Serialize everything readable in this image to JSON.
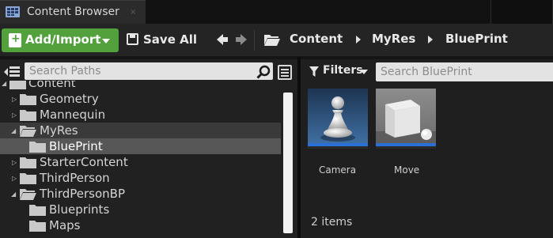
{
  "tab": {
    "title": "Content Browser",
    "icon": "content-browser-icon",
    "close_glyph": "×"
  },
  "toolbar": {
    "add_import_label": "Add/Import",
    "save_all_label": "Save All",
    "breadcrumbs": [
      "Content",
      "MyRes",
      "BluePrint"
    ],
    "accent_color": "#52a13c"
  },
  "sources": {
    "search_placeholder": "Search Paths",
    "tree": [
      {
        "label": "Content",
        "depth": 0,
        "expanded": true,
        "state": "normal"
      },
      {
        "label": "Geometry",
        "depth": 1,
        "expanded": false,
        "has_children": true,
        "state": "normal"
      },
      {
        "label": "Mannequin",
        "depth": 1,
        "expanded": false,
        "has_children": true,
        "state": "normal"
      },
      {
        "label": "MyRes",
        "depth": 1,
        "expanded": true,
        "has_children": true,
        "state": "hover"
      },
      {
        "label": "BluePrint",
        "depth": 2,
        "expanded": false,
        "has_children": false,
        "state": "selected"
      },
      {
        "label": "StarterContent",
        "depth": 1,
        "expanded": false,
        "has_children": true,
        "state": "normal"
      },
      {
        "label": "ThirdPerson",
        "depth": 1,
        "expanded": false,
        "has_children": true,
        "state": "normal"
      },
      {
        "label": "ThirdPersonBP",
        "depth": 1,
        "expanded": true,
        "has_children": true,
        "state": "normal"
      },
      {
        "label": "Blueprints",
        "depth": 2,
        "expanded": false,
        "has_children": false,
        "state": "normal"
      },
      {
        "label": "Maps",
        "depth": 2,
        "expanded": false,
        "has_children": false,
        "state": "normal"
      }
    ]
  },
  "assets": {
    "filters_label": "Filters",
    "search_placeholder": "Search BluePrint",
    "items": [
      {
        "name": "Camera",
        "thumbnail": "pawn-thumbnail"
      },
      {
        "name": "Move",
        "thumbnail": "cube-thumbnail"
      }
    ],
    "count_label": "2 items",
    "tile_bar_color": "#2a6fd6"
  }
}
